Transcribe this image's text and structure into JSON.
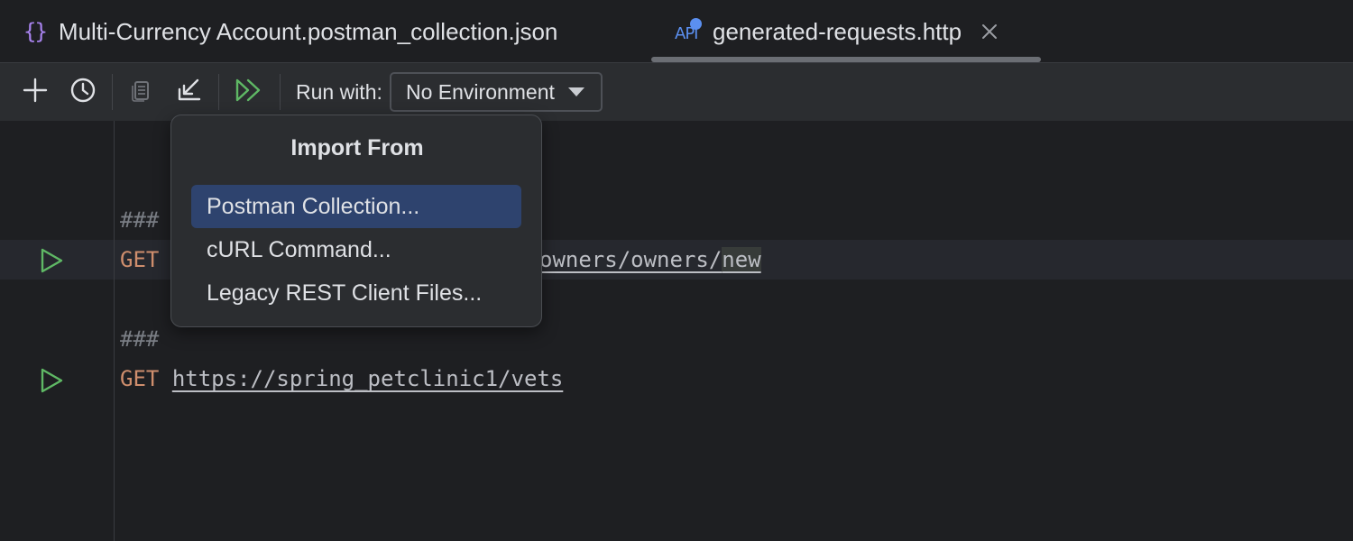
{
  "tabs": [
    {
      "label": "Multi-Currency Account.postman_collection.json",
      "icon": "json-braces-icon"
    },
    {
      "label": "generated-requests.http",
      "icon": "http-api-icon",
      "active": true
    }
  ],
  "toolbar": {
    "buttons": [
      "add-icon",
      "history-icon",
      "copy-icon",
      "import-icon",
      "run-all-icon"
    ],
    "run_with_label": "Run with:",
    "environment_value": "No Environment"
  },
  "editor": {
    "lines": [
      {
        "comment": "###"
      },
      {
        "method": "GET",
        "url_tail": "owners/owners/",
        "url_highlight": "new"
      },
      {
        "comment": "###"
      },
      {
        "method": "GET",
        "url": "https://spring_petclinic1/vets"
      }
    ]
  },
  "popup": {
    "title": "Import From",
    "items": [
      {
        "label": "Postman Collection...",
        "selected": true
      },
      {
        "label": "cURL Command..."
      },
      {
        "label": "Legacy REST Client Files..."
      }
    ]
  },
  "colors": {
    "background": "#1e1f22",
    "toolbar": "#2b2d30",
    "accent_blue": "#5b8ff0",
    "json_purple": "#a883ef",
    "run_green": "#5fb865",
    "keyword_orange": "#cf8e6d",
    "selection": "#2e436e"
  }
}
